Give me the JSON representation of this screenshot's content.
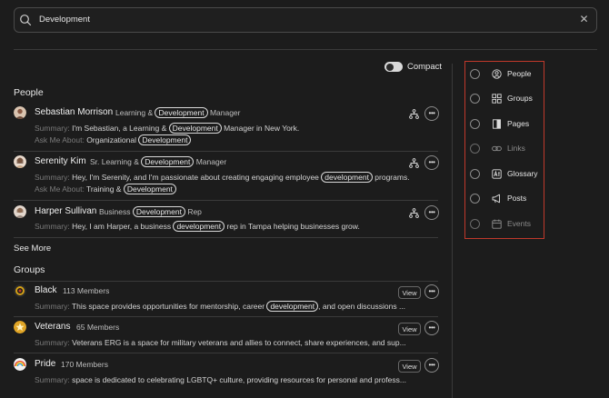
{
  "search": {
    "value": "Development",
    "clear_label": "✕"
  },
  "compact": {
    "label": "Compact"
  },
  "people": {
    "title": "People",
    "items": [
      {
        "name": "Sebastian Morrison",
        "title_pre": "Learning & ",
        "title_hl": "Development",
        "title_post": " Manager",
        "summary_label": "Summary:",
        "summary_pre": "I'm Sebastian, a Learning & ",
        "summary_hl": "Development",
        "summary_post": " Manager in New York.",
        "ask_label": "Ask Me About:",
        "ask_pre": "Organizational ",
        "ask_hl": "Development"
      },
      {
        "name": "Serenity Kim",
        "title_pre": "Sr. Learning & ",
        "title_hl": "Development",
        "title_post": " Manager",
        "summary_label": "Summary:",
        "summary_pre": "Hey, I'm Serenity, and I'm passionate about creating engaging employee ",
        "summary_hl": "development",
        "summary_post": " programs.",
        "ask_label": "Ask Me About:",
        "ask_pre": "Training & ",
        "ask_hl": "Development"
      },
      {
        "name": "Harper Sullivan",
        "title_pre": "Business ",
        "title_hl": "Development",
        "title_post": " Rep",
        "summary_label": "Summary:",
        "summary_pre": "Hey, I am Harper, a business ",
        "summary_hl": "development",
        "summary_post": " rep in Tampa helping businesses grow."
      }
    ],
    "see_more": "See More"
  },
  "groups": {
    "title": "Groups",
    "view_label": "View",
    "items": [
      {
        "name": "Black",
        "members": "113 Members",
        "summary_label": "Summary:",
        "summary_pre": "This space provides opportunities for mentorship, career ",
        "summary_hl": "development",
        "summary_post": ", and open discussions ..."
      },
      {
        "name": "Veterans",
        "members": "65 Members",
        "summary_label": "Summary:",
        "summary_pre": "Veterans ERG is a space for military veterans and allies to connect, share experiences, and sup..."
      },
      {
        "name": "Pride",
        "members": "170 Members",
        "summary_label": "Summary:",
        "summary_pre": "space is dedicated to celebrating LGBTQ+ culture, providing resources for personal and profess..."
      }
    ]
  },
  "filters": {
    "items": [
      {
        "label": "People",
        "icon": "person-circle-icon"
      },
      {
        "label": "Groups",
        "icon": "grid-icon"
      },
      {
        "label": "Pages",
        "icon": "page-icon"
      },
      {
        "label": "Links",
        "icon": "link-icon"
      },
      {
        "label": "Glossary",
        "icon": "glossary-icon"
      },
      {
        "label": "Posts",
        "icon": "megaphone-icon"
      },
      {
        "label": "Events",
        "icon": "calendar-icon"
      }
    ]
  },
  "colors": {
    "background": "#1c1c1c",
    "border": "#3a3a3a",
    "filter_outline": "#c0392b"
  }
}
